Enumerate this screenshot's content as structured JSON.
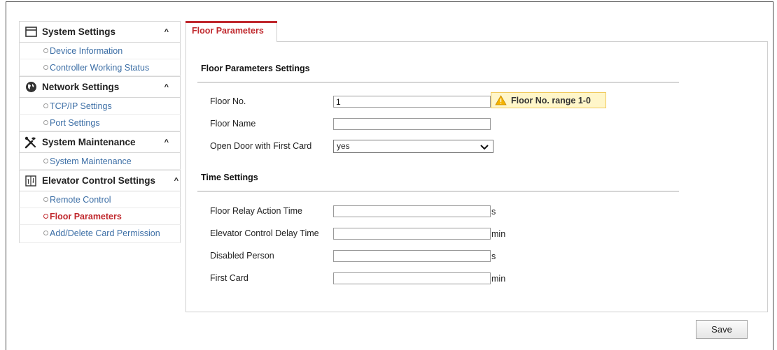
{
  "sidebar": {
    "groups": [
      {
        "title": "System Settings",
        "icon": "window-icon",
        "items": [
          "Device Information",
          "Controller Working Status"
        ]
      },
      {
        "title": "Network Settings",
        "icon": "globe-icon",
        "items": [
          "TCP/IP Settings",
          "Port Settings"
        ]
      },
      {
        "title": "System Maintenance",
        "icon": "tools-icon",
        "items": [
          "System Maintenance"
        ]
      },
      {
        "title": "Elevator Control Settings",
        "icon": "elevator-icon",
        "items": [
          "Remote Control",
          "Floor Parameters",
          "Add/Delete Card Permission"
        ]
      }
    ],
    "caret": "^",
    "active_item": "Floor Parameters"
  },
  "tab": {
    "label": "Floor Parameters"
  },
  "floor_section": {
    "title": "Floor Parameters Settings",
    "floor_no_label": "Floor No.",
    "floor_no_value": "1",
    "floor_name_label": "Floor Name",
    "floor_name_value": "",
    "open_door_label": "Open Door with First Card",
    "open_door_value": "yes",
    "warning": "Floor No. range 1-0"
  },
  "time_section": {
    "title": "Time Settings",
    "rows": [
      {
        "label": "Floor Relay Action Time",
        "value": "",
        "unit": "s"
      },
      {
        "label": "Elevator Control Delay Time",
        "value": "",
        "unit": "min"
      },
      {
        "label": "Disabled Person",
        "value": "",
        "unit": "s"
      },
      {
        "label": "First Card",
        "value": "",
        "unit": "min"
      }
    ]
  },
  "save_label": "Save",
  "colors": {
    "accent": "#c0282d",
    "link": "#3d6fa6",
    "warning_bg": "#fff6c9"
  }
}
